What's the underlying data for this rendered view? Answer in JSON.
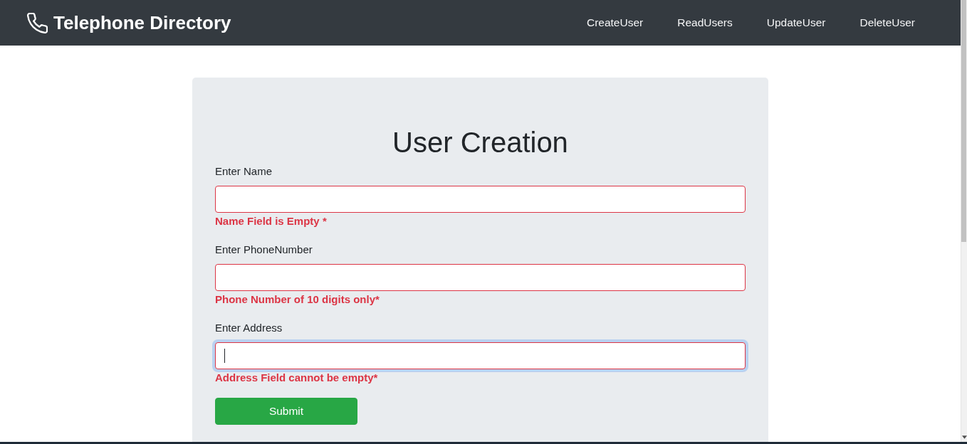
{
  "navbar": {
    "brand": "Telephone Directory",
    "links": [
      {
        "label": "CreateUser"
      },
      {
        "label": "ReadUsers"
      },
      {
        "label": "UpdateUser"
      },
      {
        "label": "DeleteUser"
      }
    ]
  },
  "form": {
    "title": "User Creation",
    "fields": [
      {
        "label": "Enter Name",
        "invalid": true,
        "focused": false,
        "error": "Name Field is Empty *"
      },
      {
        "label": "Enter PhoneNumber",
        "invalid": true,
        "focused": false,
        "error": "Phone Number of 10 digits only*"
      },
      {
        "label": "Enter Address",
        "invalid": true,
        "focused": true,
        "error": "Address Field cannot be empty*"
      }
    ],
    "submit": "Submit"
  }
}
